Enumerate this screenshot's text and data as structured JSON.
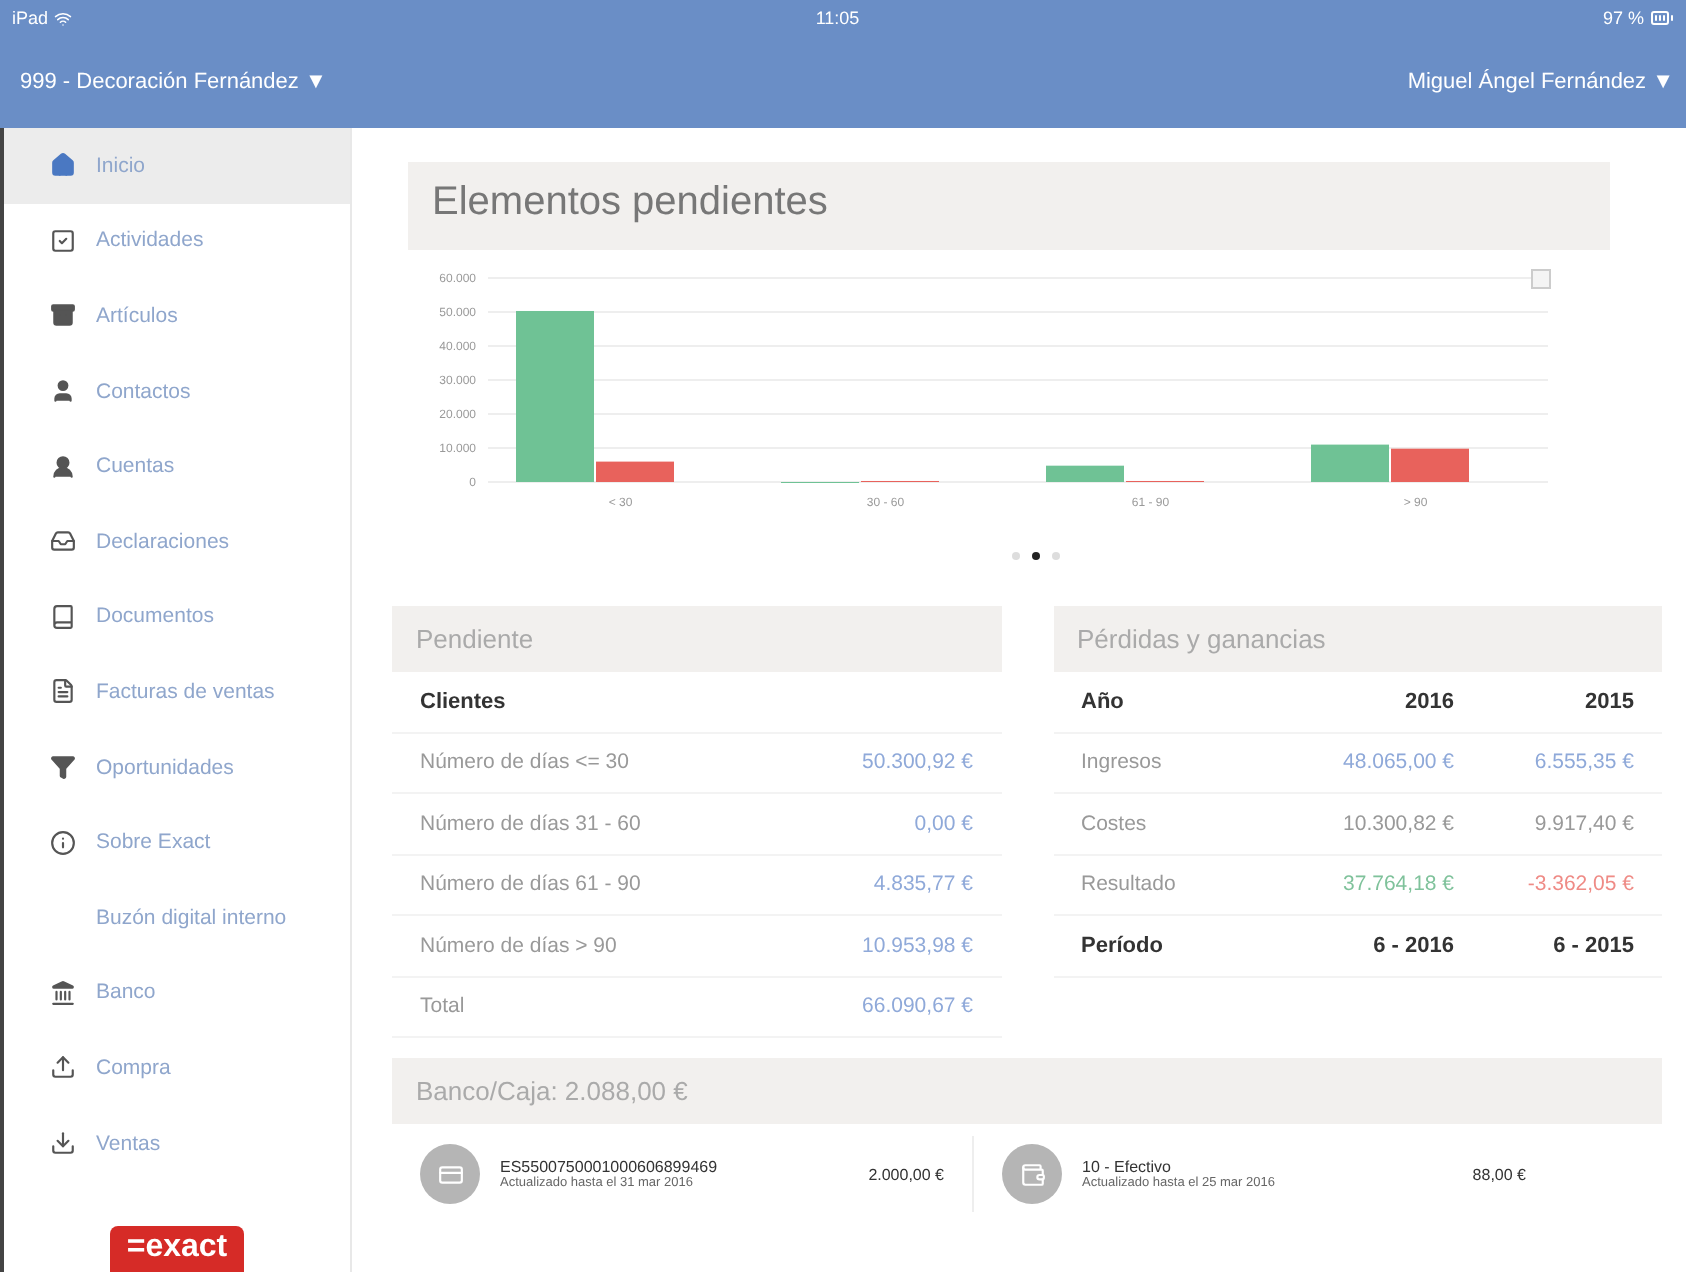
{
  "status_bar": {
    "device": "iPad",
    "time": "11:05",
    "battery": "97 %"
  },
  "header": {
    "company": "999 - Decoración Fernández ▼",
    "user": "Miguel Ángel Fernández ▼"
  },
  "sidebar": {
    "items": [
      {
        "label": "Inicio",
        "selected": true
      },
      {
        "label": "Actividades",
        "selected": false
      },
      {
        "label": "Artículos",
        "selected": false
      },
      {
        "label": "Contactos",
        "selected": false
      },
      {
        "label": "Cuentas",
        "selected": false
      },
      {
        "label": "Declaraciones",
        "selected": false
      },
      {
        "label": "Documentos",
        "selected": false
      },
      {
        "label": "Facturas de ventas",
        "selected": false
      },
      {
        "label": "Oportunidades",
        "selected": false
      },
      {
        "label": "Sobre Exact",
        "selected": false
      },
      {
        "label": "Buzón digital interno",
        "selected": false
      },
      {
        "label": "Banco",
        "selected": false
      },
      {
        "label": "Compra",
        "selected": false
      },
      {
        "label": "Ventas",
        "selected": false
      }
    ],
    "logo": "=exact"
  },
  "chart_card": {
    "title": "Elementos pendientes",
    "chart_data": {
      "type": "bar",
      "grid": true,
      "categories": [
        "< 30",
        "30 - 60",
        "61 - 90",
        "> 90"
      ],
      "ylim": [
        0,
        60000
      ],
      "yticks": [
        {
          "value": 0,
          "label": "0"
        },
        {
          "value": 10000,
          "label": "10.000"
        },
        {
          "value": 20000,
          "label": "20.000"
        },
        {
          "value": 30000,
          "label": "30.000"
        },
        {
          "value": 40000,
          "label": "40.000"
        },
        {
          "value": 50000,
          "label": "50.000"
        },
        {
          "value": 60000,
          "label": "60.000"
        }
      ],
      "series": [
        {
          "color": "#6fc295",
          "values": [
            50300,
            0,
            4800,
            11000
          ]
        },
        {
          "color": "#e8625c",
          "values": [
            6000,
            300,
            300,
            9800
          ]
        }
      ]
    },
    "pages": [
      {
        "selected": false
      },
      {
        "selected": true
      },
      {
        "selected": false
      }
    ]
  },
  "pendiente": {
    "title": "Pendiente",
    "section": "Clientes",
    "rows": [
      {
        "label": "Número de días <= 30",
        "value": "50.300,92 €"
      },
      {
        "label": "Número de días 31 - 60",
        "value": "0,00 €"
      },
      {
        "label": "Número de días 61 - 90",
        "value": "4.835,77 €"
      },
      {
        "label": "Número de días > 90",
        "value": "10.953,98 €"
      },
      {
        "label": "Total",
        "value": "66.090,67 €"
      }
    ]
  },
  "perdidas": {
    "title": "Pérdidas y ganancias",
    "header": [
      "Año",
      "2016",
      "2015"
    ],
    "rows": [
      {
        "label": "Ingresos",
        "values": [
          {
            "text": "48.065,00 €",
            "kind": "link"
          },
          {
            "text": "6.555,35 €",
            "kind": "link"
          }
        ]
      },
      {
        "label": "Costes",
        "values": [
          {
            "text": "10.300,82 €",
            "kind": "plain"
          },
          {
            "text": "9.917,40 €",
            "kind": "plain"
          }
        ]
      },
      {
        "label": "Resultado",
        "values": [
          {
            "text": "37.764,18 €",
            "kind": "positive"
          },
          {
            "text": "-3.362,05 €",
            "kind": "negative"
          }
        ]
      }
    ],
    "period_header": [
      "Período",
      "6 - 2016",
      "6 - 2015"
    ]
  },
  "banco": {
    "title": "Banco/Caja: 2.088,00 €",
    "accounts": [
      {
        "name": "ES5500750001000606899469",
        "updated": "Actualizado hasta el 31 mar 2016",
        "amount": "2.000,00 €",
        "kind": "bank"
      },
      {
        "name": "10 - Efectivo",
        "updated": "Actualizado hasta el 25 mar 2016",
        "amount": "88,00 €",
        "kind": "cash"
      }
    ]
  }
}
